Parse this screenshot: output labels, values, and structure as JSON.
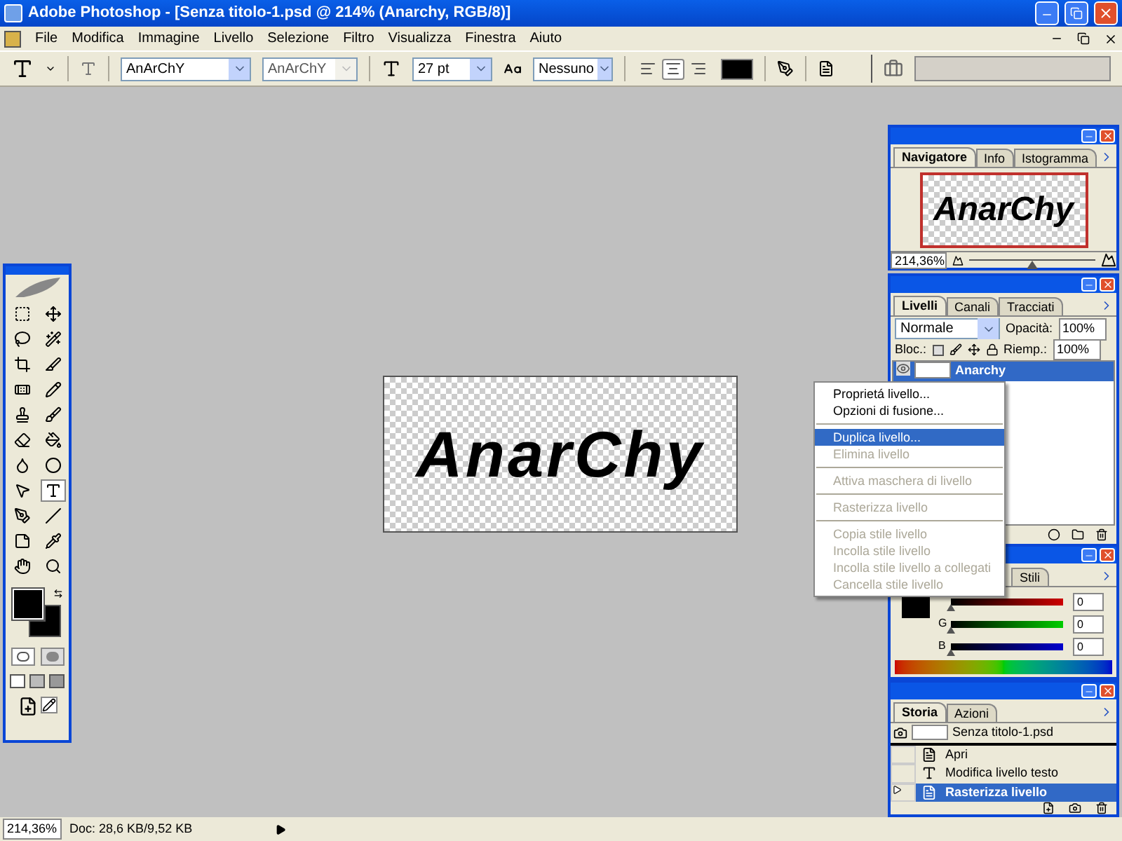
{
  "window": {
    "title": "Adobe Photoshop - [Senza titolo-1.psd @ 214% (Anarchy, RGB/8)]"
  },
  "menu_bar": {
    "items": [
      "File",
      "Modifica",
      "Immagine",
      "Livello",
      "Selezione",
      "Filtro",
      "Visualizza",
      "Finestra",
      "Aiuto"
    ]
  },
  "options_bar": {
    "font_family": "AnArChY",
    "font_style": "AnArChY",
    "font_size": "27 pt",
    "antialias": "Nessuno",
    "alignment": [
      {
        "kind": "left",
        "selected": false
      },
      {
        "kind": "center",
        "selected": true
      },
      {
        "kind": "right",
        "selected": false
      }
    ]
  },
  "toolbox": {
    "tools": [
      {
        "kind": "marquee",
        "selected": false
      },
      {
        "kind": "move",
        "selected": false
      },
      {
        "kind": "lasso",
        "selected": false
      },
      {
        "kind": "wand",
        "selected": false
      },
      {
        "kind": "crop",
        "selected": false
      },
      {
        "kind": "slice",
        "selected": false
      },
      {
        "kind": "healing",
        "selected": false
      },
      {
        "kind": "pencil",
        "selected": false
      },
      {
        "kind": "stamp",
        "selected": false
      },
      {
        "kind": "history-brush",
        "selected": false
      },
      {
        "kind": "eraser",
        "selected": false
      },
      {
        "kind": "bucket",
        "selected": false
      },
      {
        "kind": "blur",
        "selected": false
      },
      {
        "kind": "dodge",
        "selected": false
      },
      {
        "kind": "selection",
        "selected": false
      },
      {
        "kind": "type",
        "selected": true
      },
      {
        "kind": "pen",
        "selected": false
      },
      {
        "kind": "line",
        "selected": false
      },
      {
        "kind": "notes",
        "selected": false
      },
      {
        "kind": "eyedropper",
        "selected": false
      },
      {
        "kind": "hand",
        "selected": false
      },
      {
        "kind": "zoom",
        "selected": false
      }
    ]
  },
  "document": {
    "text": "AnarChy"
  },
  "navigator": {
    "tabs": [
      {
        "label": "Navigatore",
        "selected": true
      },
      {
        "label": "Info",
        "selected": false
      },
      {
        "label": "Istogramma",
        "selected": false
      }
    ],
    "preview_text": "AnarChy",
    "zoom": "214,36%",
    "zoom_slider": {
      "level": 0.5
    }
  },
  "layers": {
    "tabs": [
      {
        "label": "Livelli",
        "selected": true
      },
      {
        "label": "Canali",
        "selected": false
      },
      {
        "label": "Tracciati",
        "selected": false
      }
    ],
    "blend_mode": "Normale",
    "opacity_label": "Opacità:",
    "opacity": "100%",
    "lock_label": "Bloc.:",
    "fill_label": "Riemp.:",
    "fill": "100%",
    "layers": [
      {
        "name": "Anarchy",
        "selected": true
      }
    ]
  },
  "color": {
    "tabs": [
      {
        "label": "Stili",
        "selected": false
      }
    ],
    "channels": [
      {
        "kind": "red",
        "level": 0,
        "value": "0"
      },
      {
        "kind": "green",
        "label": "G",
        "level": 0,
        "value": "0"
      },
      {
        "kind": "blue",
        "label": "B",
        "level": 0,
        "value": "0"
      }
    ]
  },
  "history": {
    "tabs": [
      {
        "label": "Storia",
        "selected": true
      },
      {
        "label": "Azioni",
        "selected": false
      }
    ],
    "snapshot": "Senza titolo-1.psd",
    "steps": [
      {
        "kind": "document",
        "label": "Apri",
        "selected": false
      },
      {
        "kind": "type",
        "label": "Modifica livello testo",
        "selected": false
      },
      {
        "kind": "document",
        "label": "Rasterizza livello",
        "selected": true
      }
    ]
  },
  "context_menu": {
    "sections": [
      {
        "items": [
          {
            "label": "Proprietá livello...",
            "selected": false,
            "disabled": false
          },
          {
            "label": "Opzioni di fusione...",
            "selected": false,
            "disabled": false
          }
        ]
      },
      {
        "items": [
          {
            "label": "Duplica livello...",
            "selected": true,
            "disabled": false
          },
          {
            "label": "Elimina livello",
            "selected": false,
            "disabled": true
          }
        ]
      },
      {
        "items": [
          {
            "label": "Attiva maschera  di livello",
            "selected": false,
            "disabled": true
          }
        ]
      },
      {
        "items": [
          {
            "label": "Rasterizza livello",
            "selected": false,
            "disabled": true
          }
        ]
      },
      {
        "items": [
          {
            "label": "Copia stile livello",
            "selected": false,
            "disabled": true
          },
          {
            "label": "Incolla stile livello",
            "selected": false,
            "disabled": true
          },
          {
            "label": "Incolla stile livello a collegati",
            "selected": false,
            "disabled": true
          },
          {
            "label": "Cancella stile livello",
            "selected": false,
            "disabled": true
          }
        ]
      }
    ]
  },
  "status_bar": {
    "zoom": "214,36%",
    "doc_info": "Doc: 28,6 KB/9,52 KB"
  }
}
